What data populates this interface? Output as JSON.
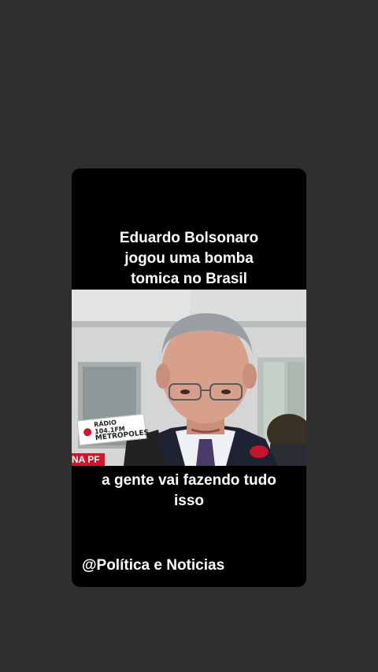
{
  "headline": {
    "line1": "Eduardo Bolsonaro",
    "line2": "jogou uma bomba",
    "line3": "tomica no Brasil"
  },
  "video": {
    "logo": {
      "line1": "RÁDIO 104.1FM",
      "line2": "METROPOLES"
    },
    "lower_third": "NA PF"
  },
  "caption": {
    "line1": "a gente vai fazendo tudo",
    "line2": "isso"
  },
  "handle": "@Política e Noticias",
  "colors": {
    "background": "#2f2f2f",
    "card": "#000000",
    "accent_red": "#d6122a",
    "text": "#ffffff"
  }
}
